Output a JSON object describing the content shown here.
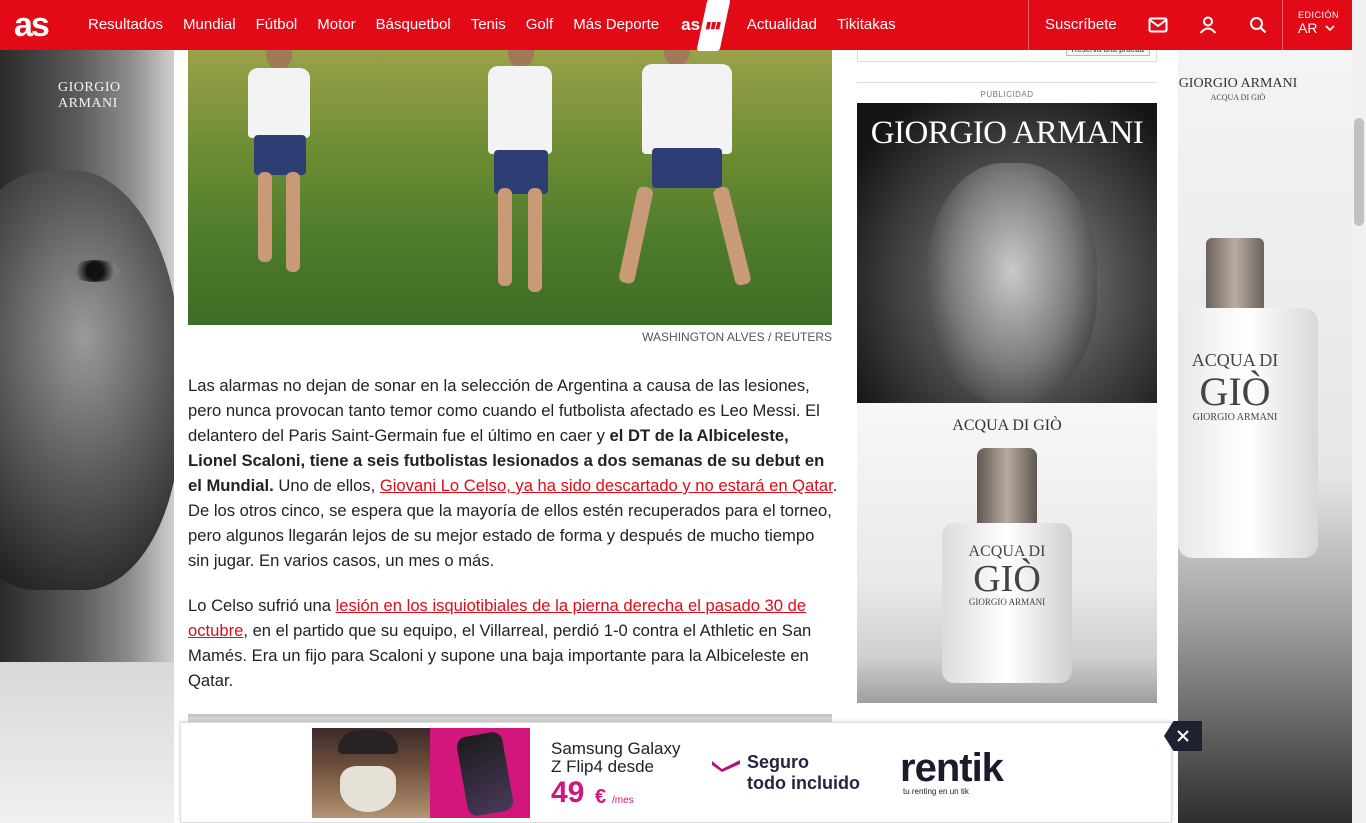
{
  "header": {
    "logo": "as",
    "nav": [
      "Resultados",
      "Mundial",
      "Fútbol",
      "Motor",
      "Básquetbol",
      "Tenis",
      "Golf",
      "Más Deporte"
    ],
    "asplus_logo": "as",
    "nav_after": [
      "Actualidad",
      "Tikitakas"
    ],
    "subscribe": "Suscríbete",
    "edition_label": "EDICIÓN",
    "edition_value": "AR",
    "icons": [
      "mail-icon",
      "user-icon",
      "search-icon",
      "chevron-down-icon"
    ]
  },
  "skins": {
    "left_brand": "GIORGIO ARMANI",
    "right_brand": "GIORGIO ARMANI",
    "right_sub": "ACQUA DI GIÒ",
    "right_bottle_line1": "ACQUA DI",
    "right_bottle_line2": "GIÒ",
    "right_bottle_line3": "GIORGIO ARMANI"
  },
  "article": {
    "photo_credit": "WASHINGTON ALVES / REUTERS",
    "p1_text1": "Las alarmas no dejan de sonar en la selección de Argentina a causa de las lesiones, pero nunca provocan tanto temor como cuando el futbolista afectado es Leo Messi. El delantero del Paris Saint-Germain fue el último en caer y ",
    "p1_bold": "el DT de la Albiceleste, Lionel Scaloni, tiene a seis futbolistas lesionados a dos semanas de su debut en el Mundial.",
    "p1_text2": " Uno de ellos, ",
    "p1_link": "Giovani Lo Celso, ya ha sido descartado y no estará en Qatar",
    "p1_text3": ". De los otros cinco, se espera que la mayoría de ellos estén recuperados para el torneo, pero algunos llegarán lejos de su mejor estado de forma y después de mucho tiempo sin jugar. En varios casos, un mes o más.",
    "p2_text1": "Lo Celso sufrió una ",
    "p2_link": "lesión en los isquiotibiales de la pierna derecha el pasado 30 de octubre",
    "p2_text2": ", en el partido que su equipo, el Villarreal, perdió 1-0 contra el Athletic en San Mamés. Era un fijo para Scaloni y supone una baja importante para la Albiceleste en Qatar."
  },
  "sidebar": {
    "top_button": "Reserva una prueba",
    "pub_label": "PUBLICIDAD",
    "ad_brand": "GIORGIO ARMANI",
    "ad_product": "ACQUA DI GIÒ",
    "ad_bottle_line1": "ACQUA DI",
    "ad_bottle_line2": "GIÒ",
    "ad_bottle_line3": "GIORGIO ARMANI"
  },
  "bottom_ad": {
    "line1": "Samsung Galaxy",
    "line2": "Z Flip4 desde",
    "price": "49",
    "currency": "€",
    "per": "/mes",
    "seguro1": "Seguro",
    "seguro2": "todo incluido",
    "brand": "rentik",
    "tagline": "tu renting en un tik"
  },
  "colors": {
    "brand_red": "#e20a17",
    "ad_pink": "#d3167d"
  }
}
